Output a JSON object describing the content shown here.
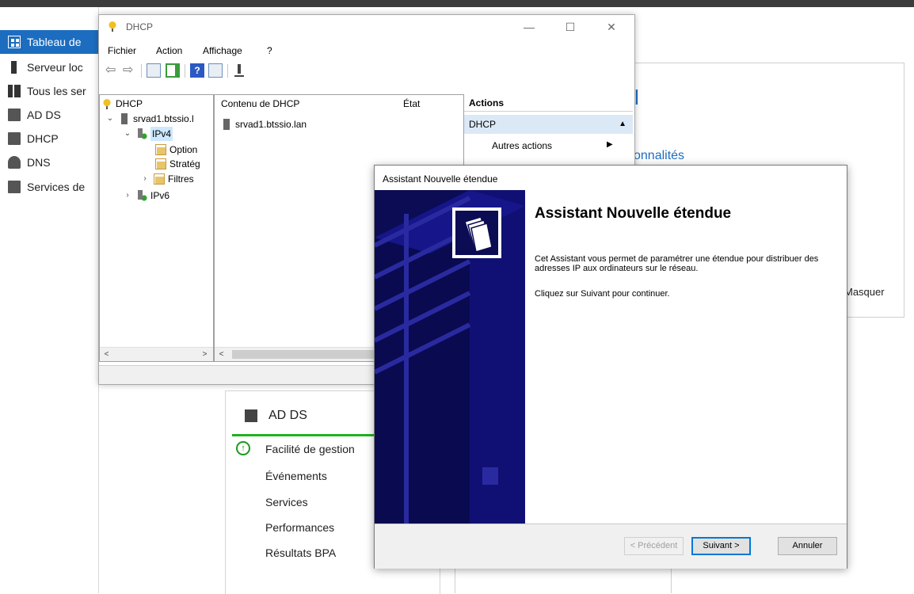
{
  "server_manager": {
    "sidebar": {
      "items": [
        {
          "label": "Tableau de",
          "icon": "dashboard-icon"
        },
        {
          "label": "Serveur loc",
          "icon": "server-icon"
        },
        {
          "label": "Tous les ser",
          "icon": "servers-icon"
        },
        {
          "label": "AD DS",
          "icon": "ad-ds-icon"
        },
        {
          "label": "DHCP",
          "icon": "dhcp-role-icon"
        },
        {
          "label": "DNS",
          "icon": "dns-icon"
        },
        {
          "label": "Services de",
          "icon": "file-services-icon"
        }
      ]
    },
    "partial_text_1": "l",
    "partial_text_2": "onnalités",
    "hide_label": "Masquer",
    "adds_tile": {
      "title": "AD DS",
      "rows": [
        "Facilité de gestion",
        "Événements",
        "Services",
        "Performances",
        "Résultats BPA"
      ]
    }
  },
  "dhcp_window": {
    "title": "DHCP",
    "menu": [
      "Fichier",
      "Action",
      "Affichage",
      "?"
    ],
    "tree": {
      "root": "DHCP",
      "server": "srvad1.btssio.l",
      "ipv4": "IPv4",
      "options": "Option",
      "strategies": "Stratég",
      "filters": "Filtres",
      "ipv6": "IPv6"
    },
    "content": {
      "col_name": "Contenu de DHCP",
      "col_state": "État",
      "rows": [
        "srvad1.btssio.lan"
      ]
    },
    "actions": {
      "header": "Actions",
      "section": "DHCP",
      "more": "Autres actions"
    }
  },
  "wizard": {
    "title": "Assistant Nouvelle étendue",
    "heading": "Assistant Nouvelle étendue",
    "description": "Cet Assistant vous permet de paramétrer une étendue pour distribuer des adresses IP aux ordinateurs sur le réseau.",
    "hint": "Cliquez sur Suivant pour continuer.",
    "buttons": {
      "back": "< Précédent",
      "next": "Suivant >",
      "cancel": "Annuler"
    }
  },
  "colors": {
    "accent": "#1c6dbf",
    "banner": "#0c0c55",
    "health_green": "#1fb21f"
  }
}
